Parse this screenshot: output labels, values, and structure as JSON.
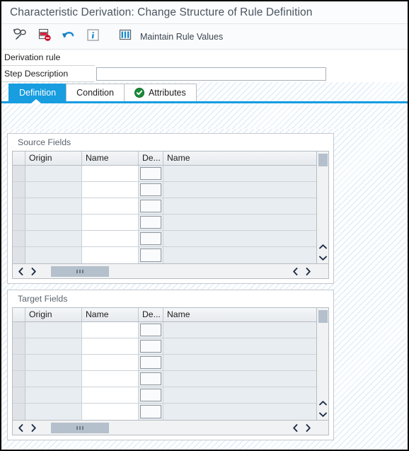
{
  "window": {
    "title": "Characteristic Derivation: Change Structure of Rule Definition"
  },
  "toolbar": {
    "buttons": [
      {
        "name": "display-change-toggle",
        "icon": "glasses-pen-icon",
        "label": ""
      },
      {
        "name": "delete-row-button",
        "icon": "delete-row-icon",
        "label": ""
      },
      {
        "name": "undo-button",
        "icon": "undo-arrow-icon",
        "label": ""
      },
      {
        "name": "information-button",
        "icon": "info-icon",
        "label": ""
      }
    ],
    "maintain_rule_values": {
      "icon": "table-columns-icon",
      "label": "Maintain Rule Values"
    }
  },
  "form": {
    "section_label": "Derivation rule",
    "step_description_label": "Step Description",
    "step_description_value": "",
    "step_description_placeholder": ""
  },
  "tabs": [
    {
      "label": "Definition",
      "active": true,
      "icon": null
    },
    {
      "label": "Condition",
      "active": false,
      "icon": null
    },
    {
      "label": "Attributes",
      "active": false,
      "icon": "green-check-icon"
    }
  ],
  "panels": [
    {
      "title": "Source Fields",
      "columns": [
        "",
        "Origin",
        "Name",
        "De...",
        "Name"
      ],
      "rows": [
        [
          "",
          "",
          "",
          "",
          ""
        ],
        [
          "",
          "",
          "",
          "",
          ""
        ],
        [
          "",
          "",
          "",
          "",
          ""
        ],
        [
          "",
          "",
          "",
          "",
          ""
        ],
        [
          "",
          "",
          "",
          "",
          ""
        ],
        [
          "",
          "",
          "",
          "",
          ""
        ]
      ]
    },
    {
      "title": "Target Fields",
      "columns": [
        "",
        "Origin",
        "Name",
        "De...",
        "Name"
      ],
      "rows": [
        [
          "",
          "",
          "",
          "",
          ""
        ],
        [
          "",
          "",
          "",
          "",
          ""
        ],
        [
          "",
          "",
          "",
          "",
          ""
        ],
        [
          "",
          "",
          "",
          "",
          ""
        ],
        [
          "",
          "",
          "",
          "",
          ""
        ],
        [
          "",
          "",
          "",
          "",
          ""
        ]
      ]
    }
  ],
  "colors": {
    "accent_blue": "#179de0",
    "check_green": "#198c38",
    "delete_red": "#d00020",
    "grid_row": "#e8edf1",
    "scroll_thumb": "#b4c0cc"
  }
}
